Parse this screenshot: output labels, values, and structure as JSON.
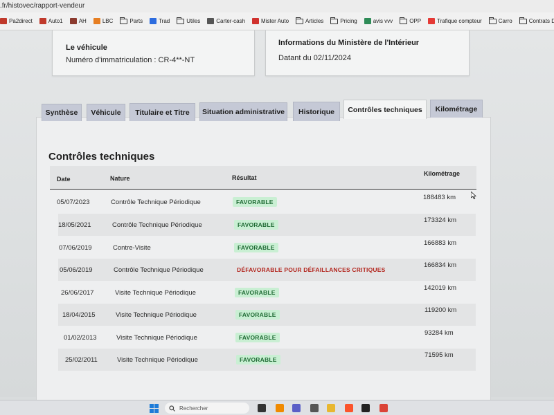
{
  "browser": {
    "url": ".fr/histovec/rapport-vendeur",
    "bookmarks": [
      {
        "label": "Pa2direct",
        "color": "#c0392b",
        "kind": "site"
      },
      {
        "label": "Auto1",
        "color": "#c0392b",
        "kind": "site"
      },
      {
        "label": "AH",
        "color": "#8b3a2e",
        "kind": "site"
      },
      {
        "label": "LBC",
        "color": "#e67e22",
        "kind": "site"
      },
      {
        "label": "Parts",
        "color": "#333333",
        "kind": "folder"
      },
      {
        "label": "Trad",
        "color": "#2d6cdf",
        "kind": "site"
      },
      {
        "label": "Utiles",
        "color": "#333333",
        "kind": "folder"
      },
      {
        "label": "Carter-cash",
        "color": "#555555",
        "kind": "site"
      },
      {
        "label": "Mister Auto",
        "color": "#d0312d",
        "kind": "site"
      },
      {
        "label": "Articles",
        "color": "#333333",
        "kind": "folder"
      },
      {
        "label": "Pricing",
        "color": "#333333",
        "kind": "folder"
      },
      {
        "label": "avis vvv",
        "color": "#2e8b57",
        "kind": "site"
      },
      {
        "label": "OPP",
        "color": "#333333",
        "kind": "folder"
      },
      {
        "label": "Trafique compteur",
        "color": "#e53935",
        "kind": "site"
      },
      {
        "label": "Carro",
        "color": "#333333",
        "kind": "folder"
      },
      {
        "label": "Contrats Distance",
        "color": "#333333",
        "kind": "folder"
      }
    ]
  },
  "vehicle_card": {
    "title": "Le véhicule",
    "plate_text": "Numéro d'immatriculation : CR-4**-NT"
  },
  "ministry_card": {
    "title": "Informations du Ministère de l'Intérieur",
    "date_text": "Datant du 02/11/2024"
  },
  "tabs": [
    {
      "label": "Synthèse",
      "active": false
    },
    {
      "label": "Véhicule",
      "active": false
    },
    {
      "label": "Titulaire et Titre",
      "active": false
    },
    {
      "label": "Situation administrative",
      "active": false
    },
    {
      "label": "Historique",
      "active": false
    },
    {
      "label": "Contrôles techniques",
      "active": true
    },
    {
      "label": "Kilométrage",
      "active": false
    }
  ],
  "section_title": "Contrôles techniques",
  "table": {
    "headers": {
      "date": "Date",
      "nature": "Nature",
      "result": "Résultat",
      "mileage": "Kilométrage"
    },
    "rows": [
      {
        "date": "05/07/2023",
        "nature": "Contrôle Technique Périodique",
        "result": "FAVORABLE",
        "status": "favorable",
        "mileage": "188483 km"
      },
      {
        "date": "18/05/2021",
        "nature": "Contrôle Technique Périodique",
        "result": "FAVORABLE",
        "status": "favorable",
        "mileage": "173324 km"
      },
      {
        "date": "07/06/2019",
        "nature": "Contre-Visite",
        "result": "FAVORABLE",
        "status": "favorable",
        "mileage": "166883 km"
      },
      {
        "date": "05/06/2019",
        "nature": "Contrôle Technique Périodique",
        "result": "DÉFAVORABLE POUR DÉFAILLANCES CRITIQUES",
        "status": "defavorable",
        "mileage": "166834 km"
      },
      {
        "date": "26/06/2017",
        "nature": "Visite Technique Périodique",
        "result": "FAVORABLE",
        "status": "favorable",
        "mileage": "142019 km"
      },
      {
        "date": "18/04/2015",
        "nature": "Visite Technique Périodique",
        "result": "FAVORABLE",
        "status": "favorable",
        "mileage": "119200 km"
      },
      {
        "date": "01/02/2013",
        "nature": "Visite Technique Périodique",
        "result": "FAVORABLE",
        "status": "favorable",
        "mileage": "93284 km"
      },
      {
        "date": "25/02/2011",
        "nature": "Visite Technique Périodique",
        "result": "FAVORABLE",
        "status": "favorable",
        "mileage": "71595 km"
      }
    ]
  },
  "taskbar": {
    "search_placeholder": "Rechercher",
    "apps": [
      {
        "name": "file-explorer-icon",
        "color": "#333333"
      },
      {
        "name": "vlc-icon",
        "color": "#f08a00"
      },
      {
        "name": "teams-icon",
        "color": "#5b5fc7"
      },
      {
        "name": "calculator-icon",
        "color": "#555555"
      },
      {
        "name": "folder-icon",
        "color": "#e8b730"
      },
      {
        "name": "brave-icon",
        "color": "#fb542b"
      },
      {
        "name": "sticky-notes-icon",
        "color": "#222222"
      },
      {
        "name": "chrome-icon",
        "color": "#db4437"
      }
    ]
  },
  "colors": {
    "favorable_bg": "#c9efd3",
    "favorable_text": "#1f6b34",
    "defavorable_text": "#b3261e",
    "tab_bg": "#c5c9d6"
  }
}
